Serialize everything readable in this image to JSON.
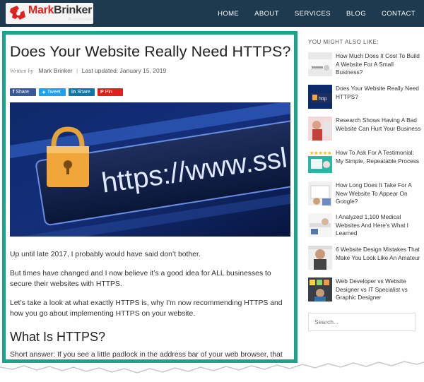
{
  "header": {
    "logo": {
      "mark": "Mark",
      "name": "Brinker",
      "sub": "& associates"
    },
    "nav": [
      "HOME",
      "ABOUT",
      "SERVICES",
      "BLOG",
      "CONTACT"
    ]
  },
  "article": {
    "title": "Does Your Website Really Need HTTPS?",
    "byline": {
      "written_by": "Written by",
      "author": "Mark Brinker",
      "updated": "Last updated: January 15, 2019"
    },
    "share": {
      "facebook": "Share",
      "twitter": "Tweet",
      "linkedin": "Share",
      "pinterest": "Pin"
    },
    "hero_text": "https://www.ssl",
    "paragraphs": [
      "Up until late 2017, I probably would have said don’t bother.",
      "But times have changed and I now believe it’s a good idea for ALL businesses to secure their websites with HTTPS.",
      "Let’s take a look at what exactly HTTPS is, why I’m now recommending HTTPS and how you go about implementing HTTPS on your website."
    ],
    "heading2": "What Is HTTPS?",
    "paragraph4": "Short answer: If you see a little padlock in the address bar of your web browser, that means you’re visiting a secure website, which means that the data you’re sending to or receiving"
  },
  "sidebar": {
    "title": "YOU MIGHT ALSO LIKE:",
    "items": [
      {
        "label": "How Much Does It Cost To Build A Website For A Small Business?"
      },
      {
        "label": "Does Your Website Really Need HTTPS?"
      },
      {
        "label": "Research Shows Having A Bad Website Can Hurt Your Business"
      },
      {
        "label": "How To Ask For A Testimonial: My Simple, Repeatable Process"
      },
      {
        "label": "How Long Does It Take For A New Website To Appear On Google?"
      },
      {
        "label": "I Analyzed 1,100 Medical Websites And Here’s What I Learned"
      },
      {
        "label": "6 Website Design Mistakes That Make You Look Like An Amateur"
      },
      {
        "label": "Web Developer vs Website Designer vs IT Specialist vs Graphic Designer"
      }
    ],
    "search_placeholder": "Search..."
  },
  "colors": {
    "header_bg": "#1e3a4f",
    "frame": "#1aa58b",
    "logo_red": "#e0211d"
  }
}
